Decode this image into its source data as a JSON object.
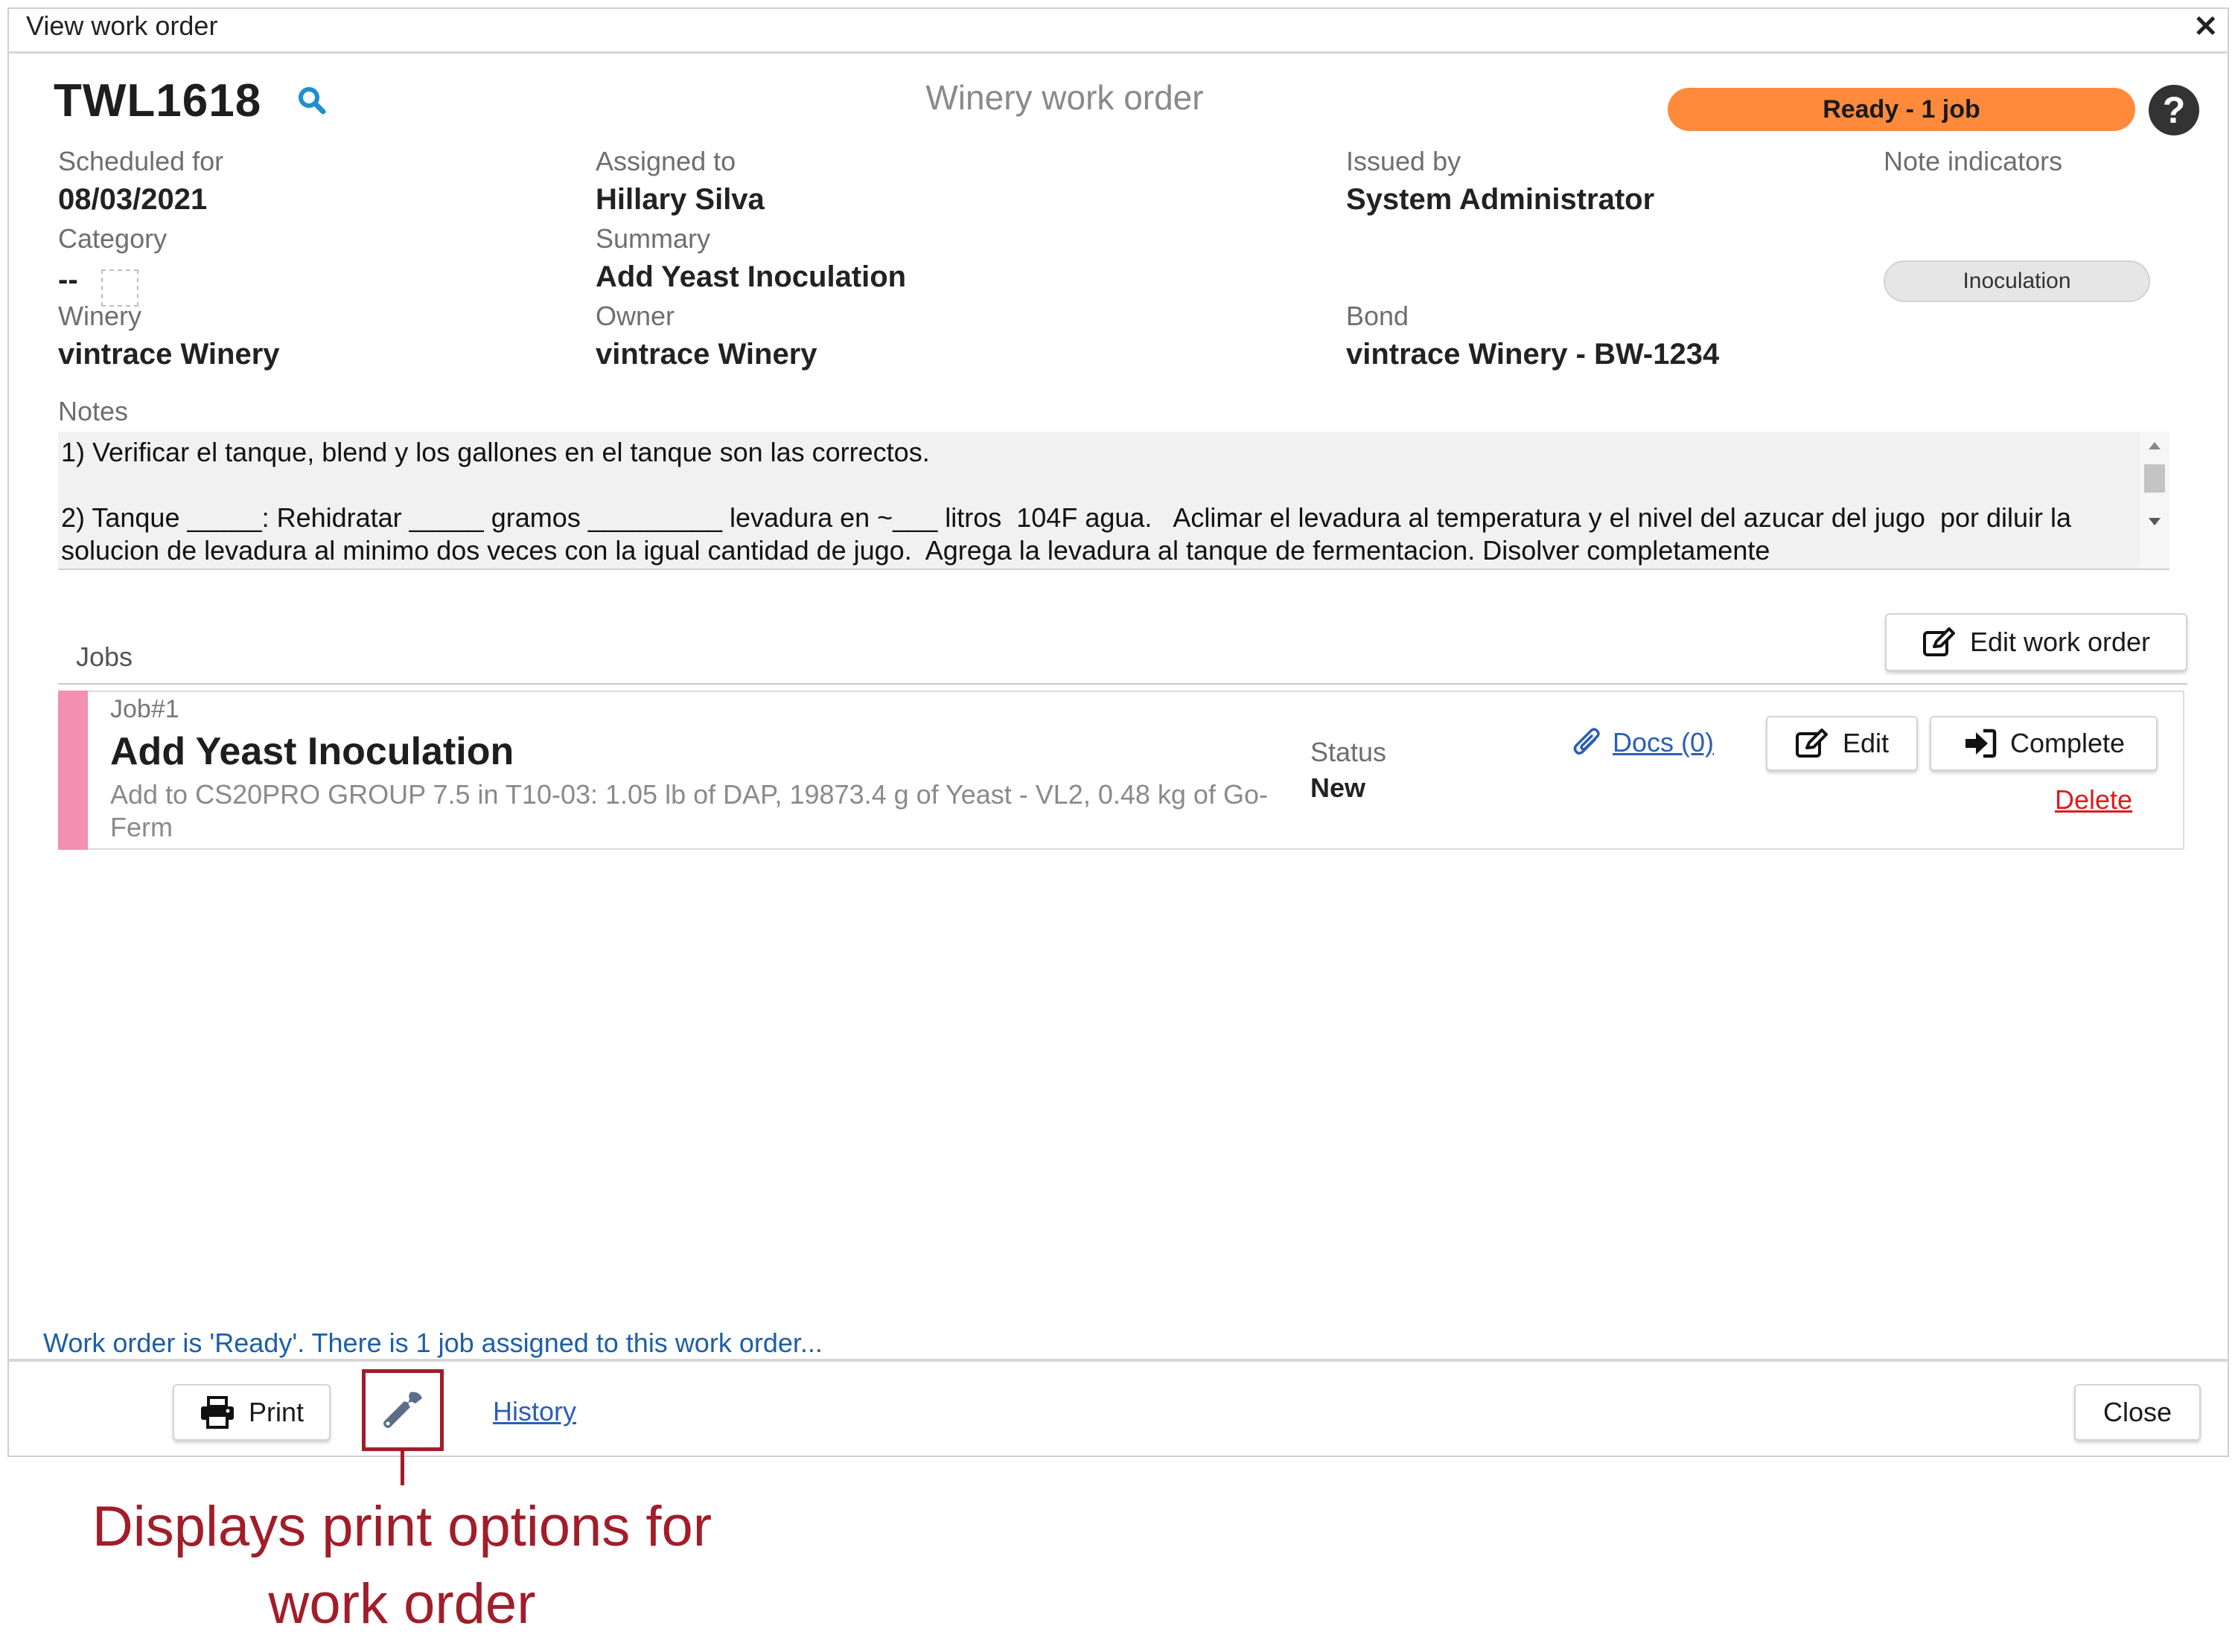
{
  "window": {
    "title": "View work order"
  },
  "header": {
    "work_order_id": "TWL1618",
    "type_title": "Winery work order",
    "status_badge": "Ready - 1 job",
    "status_color": "#ff8a3c"
  },
  "fields": {
    "scheduled_for": {
      "label": "Scheduled for",
      "value": "08/03/2021"
    },
    "category": {
      "label": "Category",
      "value": "--"
    },
    "winery": {
      "label": "Winery",
      "value": "vintrace Winery"
    },
    "assigned_to": {
      "label": "Assigned to",
      "value": "Hillary Silva"
    },
    "summary": {
      "label": "Summary",
      "value": "Add Yeast Inoculation"
    },
    "owner": {
      "label": "Owner",
      "value": "vintrace Winery"
    },
    "issued_by": {
      "label": "Issued by",
      "value": "System Administrator"
    },
    "bond": {
      "label": "Bond",
      "value": "vintrace Winery - BW-1234"
    },
    "note_indicators": {
      "label": "Note indicators",
      "chips": [
        "Inoculation"
      ]
    }
  },
  "notes": {
    "label": "Notes",
    "text": "1) Verificar el tanque, blend y los gallones en el tanque son las correctos.\n\n2) Tanque _____: Rehidratar _____ gramos _________ levadura en ~___ litros  104F agua.   Aclimar el levadura al temperatura y el nivel del azucar del jugo  por diluir la solucion de levadura al minimo dos veces con la igual cantidad de jugo.  Agrega la levadura al tanque de fermentacion. Disolver completamente"
  },
  "jobs": {
    "label": "Jobs",
    "edit_work_order_label": "Edit work order",
    "items": [
      {
        "number": "Job#1",
        "title": "Add Yeast Inoculation",
        "description": "Add to CS20PRO GROUP 7.5 in T10-03: 1.05 lb of DAP, 19873.4 g of Yeast - VL2, 0.48 kg of Go-Ferm",
        "status_label": "Status",
        "status_value": "New",
        "docs_label": "Docs (0)",
        "edit_label": "Edit",
        "complete_label": "Complete",
        "delete_label": "Delete",
        "stripe_color": "#f38fb1"
      }
    ]
  },
  "status_bar": {
    "text": "Work order is 'Ready'. There is 1 job assigned to this work order..."
  },
  "footer": {
    "print_label": "Print",
    "history_label": "History",
    "close_label": "Close"
  },
  "annotation": {
    "callout_text": "Displays print options for work order",
    "color": "#a11d2a"
  }
}
